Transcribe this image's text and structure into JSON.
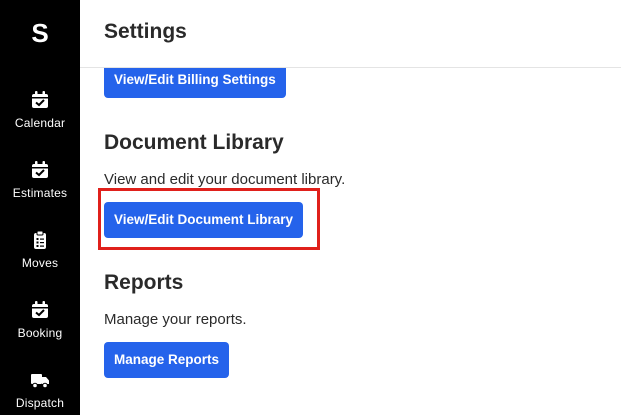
{
  "sidebar": {
    "logo": "S",
    "items": [
      {
        "label": "Calendar",
        "icon": "calendar-check-icon"
      },
      {
        "label": "Estimates",
        "icon": "calendar-check-icon"
      },
      {
        "label": "Moves",
        "icon": "clipboard-list-icon"
      },
      {
        "label": "Booking",
        "icon": "calendar-check-icon"
      },
      {
        "label": "Dispatch",
        "icon": "truck-icon"
      }
    ]
  },
  "header": {
    "title": "Settings"
  },
  "billing": {
    "button_label": "View/Edit Billing Settings"
  },
  "document_library": {
    "title": "Document Library",
    "description": "View and edit your document library.",
    "button_label": "View/Edit Document Library"
  },
  "reports": {
    "title": "Reports",
    "description": "Manage your reports.",
    "button_label": "Manage Reports"
  },
  "colors": {
    "accent": "#2563eb",
    "sidebar": "#000000",
    "highlight": "#e0201b"
  }
}
